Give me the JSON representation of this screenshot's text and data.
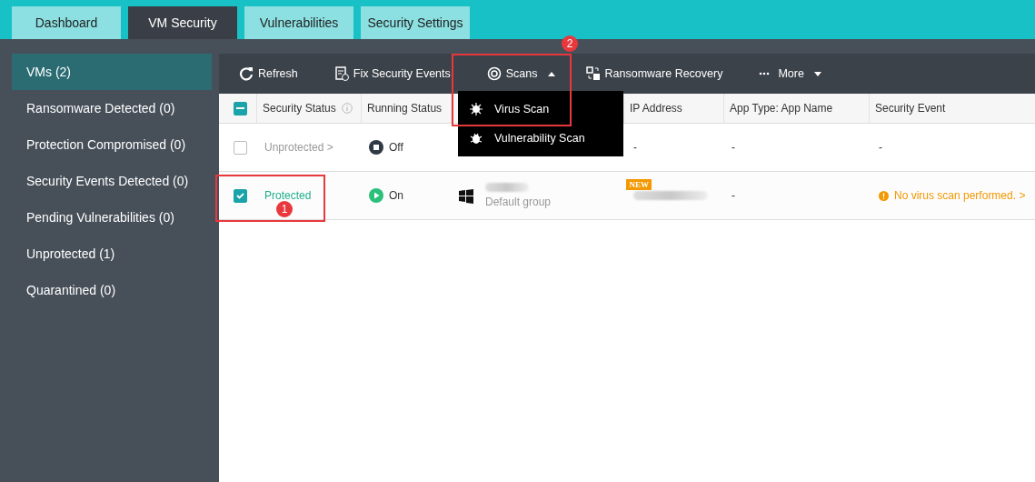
{
  "tabs": [
    {
      "label": "Dashboard",
      "selected": false
    },
    {
      "label": "VM Security",
      "selected": true
    },
    {
      "label": "Vulnerabilities",
      "selected": false
    },
    {
      "label": "Security Settings",
      "selected": false
    }
  ],
  "sidebar": {
    "items": [
      {
        "label": "VMs (2)",
        "selected": true
      },
      {
        "label": "Ransomware Detected (0)",
        "selected": false
      },
      {
        "label": "Protection Compromised (0)",
        "selected": false
      },
      {
        "label": "Security Events Detected (0)",
        "selected": false
      },
      {
        "label": "Pending Vulnerabilities (0)",
        "selected": false
      },
      {
        "label": "Unprotected (1)",
        "selected": false
      },
      {
        "label": "Quarantined (0)",
        "selected": false
      }
    ]
  },
  "toolbar": [
    {
      "kind": "refresh",
      "label": "Refresh"
    },
    {
      "kind": "fix",
      "label": "Fix Security Events"
    },
    {
      "kind": "scans",
      "label": "Scans",
      "expanded": true
    },
    {
      "kind": "recovery",
      "label": "Ransomware Recovery"
    },
    {
      "kind": "more",
      "label": "More",
      "expanded": false
    }
  ],
  "scans_menu": [
    {
      "kind": "virus",
      "label": "Virus Scan"
    },
    {
      "kind": "vuln",
      "label": "Vulnerability Scan"
    }
  ],
  "table": {
    "select_all": {
      "indeterminate": true
    },
    "columns": [
      "Security Status",
      "Running Status",
      "IP Address",
      "App Type: App Name",
      "Security Event"
    ],
    "rows": [
      {
        "checked": false,
        "status": "Unprotected >",
        "protected": false,
        "running": "Off",
        "on": false,
        "new": false,
        "ip": "-",
        "app": "-",
        "event": "-",
        "warning": false
      },
      {
        "checked": true,
        "status": "Protected",
        "protected": true,
        "running": "On",
        "on": true,
        "group": "Default group",
        "new": true,
        "new_label": "NEW",
        "app": "-",
        "event": "No virus scan performed. >",
        "warning": true
      }
    ]
  },
  "annotations": [
    {
      "label": "1",
      "kind": "status"
    },
    {
      "label": "2",
      "kind": "scans"
    }
  ]
}
